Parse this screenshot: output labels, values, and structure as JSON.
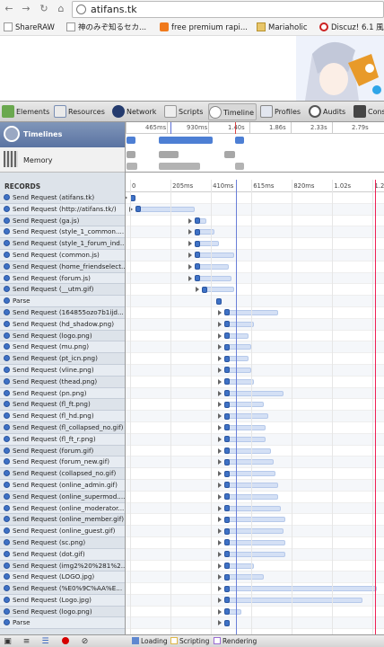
{
  "browser": {
    "url": "atifans.tk",
    "bookmarks": [
      {
        "label": "ShareRAW",
        "icon": "doc-icon"
      },
      {
        "label": "神のみぞ知るセカ...",
        "icon": "doc-icon"
      },
      {
        "label": "free premium rapi...",
        "icon": "blogger-icon"
      },
      {
        "label": "Mariaholic",
        "icon": "folder-icon"
      },
      {
        "label": "Discuz! 6.1 風",
        "icon": "discuz-icon"
      }
    ]
  },
  "devtools": {
    "tabs": [
      {
        "label": "Elements",
        "icon": "elements-icon"
      },
      {
        "label": "Resources",
        "icon": "resources-icon"
      },
      {
        "label": "Network",
        "icon": "network-icon"
      },
      {
        "label": "Scripts",
        "icon": "scripts-icon"
      },
      {
        "label": "Timeline",
        "icon": "timeline-icon",
        "active": true
      },
      {
        "label": "Profiles",
        "icon": "profiles-icon"
      },
      {
        "label": "Audits",
        "icon": "audits-icon"
      },
      {
        "label": "Cons",
        "icon": "console-icon"
      }
    ],
    "sidebar": {
      "timelines_label": "Timelines",
      "memory_label": "Memory",
      "records_label": "RECORDS"
    },
    "overview_ticks": [
      "465ms",
      "930ms",
      "1.40s",
      "1.86s",
      "2.33s",
      "2.79s"
    ],
    "grid_ticks": [
      "0",
      "205ms",
      "410ms",
      "615ms",
      "820ms",
      "1.02s",
      "1.23s"
    ],
    "records": [
      {
        "label": "Send Request (atifans.tk)",
        "start": 0.0,
        "dur": 0.02,
        "expand": true
      },
      {
        "label": "Send Request (http://atifans.tk/)",
        "start": 0.02,
        "dur": 0.24,
        "expand": true
      },
      {
        "label": "Send Request (ga.js)",
        "start": 0.26,
        "dur": 0.05,
        "expand": true
      },
      {
        "label": "Send Request (style_1_common....",
        "start": 0.26,
        "dur": 0.08,
        "expand": true
      },
      {
        "label": "Send Request (style_1_forum_ind...",
        "start": 0.26,
        "dur": 0.1,
        "expand": true
      },
      {
        "label": "Send Request (common.js)",
        "start": 0.26,
        "dur": 0.16,
        "expand": true
      },
      {
        "label": "Send Request (home_friendselect...",
        "start": 0.26,
        "dur": 0.14,
        "expand": true
      },
      {
        "label": "Send Request (forum.js)",
        "start": 0.26,
        "dur": 0.15,
        "expand": true
      },
      {
        "label": "Send Request (__utm.gif)",
        "start": 0.29,
        "dur": 0.13,
        "expand": true
      },
      {
        "label": "Parse",
        "start": 0.35,
        "dur": 0.01,
        "expand": false
      },
      {
        "label": "Send Request (164855ozo7b1ijd...",
        "start": 0.38,
        "dur": 0.22,
        "expand": true
      },
      {
        "label": "Send Request (hd_shadow.png)",
        "start": 0.38,
        "dur": 0.12,
        "expand": true
      },
      {
        "label": "Send Request (logo.png)",
        "start": 0.38,
        "dur": 0.1,
        "expand": true
      },
      {
        "label": "Send Request (mu.png)",
        "start": 0.38,
        "dur": 0.11,
        "expand": true
      },
      {
        "label": "Send Request (pt_icn.png)",
        "start": 0.38,
        "dur": 0.1,
        "expand": true
      },
      {
        "label": "Send Request (vline.png)",
        "start": 0.38,
        "dur": 0.11,
        "expand": true
      },
      {
        "label": "Send Request (thead.png)",
        "start": 0.38,
        "dur": 0.12,
        "expand": true
      },
      {
        "label": "Send Request (pn.png)",
        "start": 0.38,
        "dur": 0.24,
        "expand": true
      },
      {
        "label": "Send Request (fl_ft.png)",
        "start": 0.38,
        "dur": 0.16,
        "expand": true
      },
      {
        "label": "Send Request (fl_hd.png)",
        "start": 0.38,
        "dur": 0.18,
        "expand": true
      },
      {
        "label": "Send Request (fl_collapsed_no.gif)",
        "start": 0.38,
        "dur": 0.17,
        "expand": true
      },
      {
        "label": "Send Request (fl_ft_r.png)",
        "start": 0.38,
        "dur": 0.17,
        "expand": true
      },
      {
        "label": "Send Request (forum.gif)",
        "start": 0.38,
        "dur": 0.19,
        "expand": true
      },
      {
        "label": "Send Request (forum_new.gif)",
        "start": 0.38,
        "dur": 0.2,
        "expand": true
      },
      {
        "label": "Send Request (collapsed_no.gif)",
        "start": 0.38,
        "dur": 0.21,
        "expand": true
      },
      {
        "label": "Send Request (online_admin.gif)",
        "start": 0.38,
        "dur": 0.22,
        "expand": true
      },
      {
        "label": "Send Request (online_supermod....",
        "start": 0.38,
        "dur": 0.22,
        "expand": true
      },
      {
        "label": "Send Request (online_moderator....",
        "start": 0.38,
        "dur": 0.23,
        "expand": true
      },
      {
        "label": "Send Request (online_member.gif)",
        "start": 0.38,
        "dur": 0.25,
        "expand": true
      },
      {
        "label": "Send Request (online_guest.gif)",
        "start": 0.38,
        "dur": 0.24,
        "expand": true
      },
      {
        "label": "Send Request (sc.png)",
        "start": 0.38,
        "dur": 0.25,
        "expand": true
      },
      {
        "label": "Send Request (dot.gif)",
        "start": 0.38,
        "dur": 0.25,
        "expand": true
      },
      {
        "label": "Send Request (img2%20%281%2...",
        "start": 0.38,
        "dur": 0.12,
        "expand": true
      },
      {
        "label": "Send Request (LOGO.jpg)",
        "start": 0.38,
        "dur": 0.16,
        "expand": true
      },
      {
        "label": "Send Request (%E0%9C%AA%E...",
        "start": 0.38,
        "dur": 0.62,
        "expand": true
      },
      {
        "label": "Send Request (Logo.jpg)",
        "start": 0.38,
        "dur": 0.56,
        "expand": true
      },
      {
        "label": "Send Request (logo.png)",
        "start": 0.38,
        "dur": 0.07,
        "expand": true
      },
      {
        "label": "Parse",
        "start": 0.38,
        "dur": 0.02,
        "expand": true
      }
    ],
    "filters": [
      {
        "label": "Loading",
        "checked": true,
        "color": "#5f88d0"
      },
      {
        "label": "Scripting",
        "checked": false,
        "color": "#e0b84a"
      },
      {
        "label": "Rendering",
        "checked": false,
        "color": "#9a6cd3"
      }
    ]
  }
}
